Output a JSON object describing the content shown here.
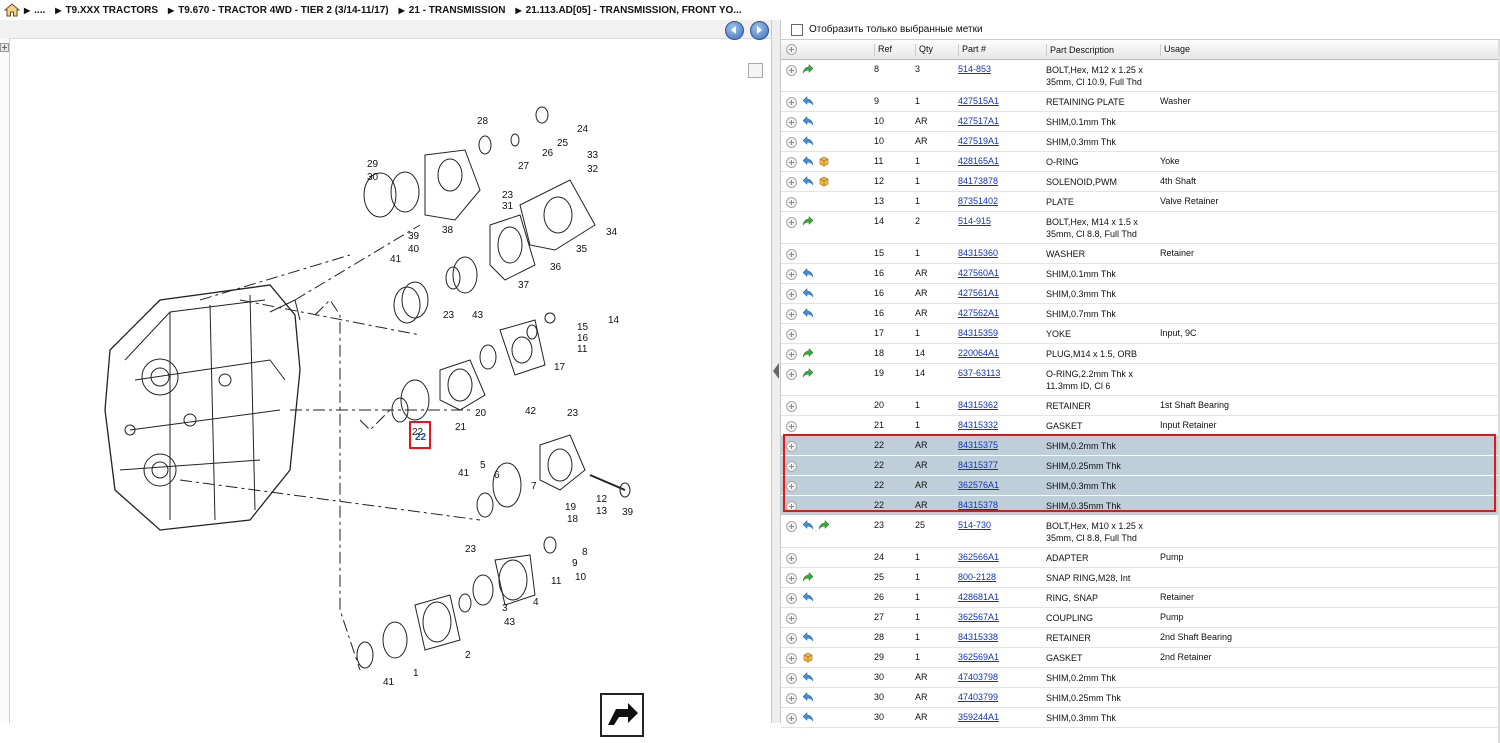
{
  "breadcrumb": {
    "items": [
      "....",
      "T9.XXX TRACTORS",
      "T9.670 - TRACTOR 4WD - TIER 2 (3/14-11/17)",
      "21 - TRANSMISSION",
      "21.113.AD[05] - TRANSMISSION, FRONT YO..."
    ]
  },
  "filter": {
    "label": "Отобразить только выбранные метки"
  },
  "table": {
    "headers": {
      "ref": "Ref",
      "qty": "Qty",
      "part": "Part #",
      "desc": "Part Description",
      "usage": "Usage"
    },
    "rows": [
      {
        "ref": "8",
        "qty": "3",
        "part": "514-853",
        "desc": "BOLT,Hex, M12 x 1.25 x 35mm, Cl 10.9, Full Thd",
        "usage": "",
        "icons": [
          "green-arrow-icon"
        ],
        "sel": false
      },
      {
        "ref": "9",
        "qty": "1",
        "part": "427515A1",
        "desc": "RETAINING PLATE",
        "usage": "Washer",
        "icons": [
          "blue-arrow-icon"
        ],
        "sel": false
      },
      {
        "ref": "10",
        "qty": "AR",
        "part": "427517A1",
        "desc": "SHIM,0.1mm Thk",
        "usage": "",
        "icons": [
          "blue-arrow-icon"
        ],
        "sel": false
      },
      {
        "ref": "10",
        "qty": "AR",
        "part": "427519A1",
        "desc": "SHIM,0.3mm Thk",
        "usage": "",
        "icons": [
          "blue-arrow-icon"
        ],
        "sel": false
      },
      {
        "ref": "11",
        "qty": "1",
        "part": "428165A1",
        "desc": "O-RING",
        "usage": "Yoke",
        "icons": [
          "blue-arrow-icon",
          "box-icon"
        ],
        "sel": false
      },
      {
        "ref": "12",
        "qty": "1",
        "part": "84173878",
        "desc": "SOLENOID,PWM",
        "usage": "4th Shaft",
        "icons": [
          "blue-arrow-icon",
          "box-icon"
        ],
        "sel": false
      },
      {
        "ref": "13",
        "qty": "1",
        "part": "87351402",
        "desc": "PLATE",
        "usage": "Valve Retainer",
        "icons": [],
        "sel": false
      },
      {
        "ref": "14",
        "qty": "2",
        "part": "514-915",
        "desc": "BOLT,Hex, M14 x 1.5 x 35mm, Cl 8.8, Full Thd",
        "usage": "",
        "icons": [
          "green-arrow-icon"
        ],
        "sel": false
      },
      {
        "ref": "15",
        "qty": "1",
        "part": "84315360",
        "desc": "WASHER",
        "usage": "Retainer",
        "icons": [],
        "sel": false
      },
      {
        "ref": "16",
        "qty": "AR",
        "part": "427560A1",
        "desc": "SHIM,0.1mm Thk",
        "usage": "",
        "icons": [
          "blue-arrow-icon"
        ],
        "sel": false
      },
      {
        "ref": "16",
        "qty": "AR",
        "part": "427561A1",
        "desc": "SHIM,0.3mm Thk",
        "usage": "",
        "icons": [
          "blue-arrow-icon"
        ],
        "sel": false
      },
      {
        "ref": "16",
        "qty": "AR",
        "part": "427562A1",
        "desc": "SHIM,0.7mm Thk",
        "usage": "",
        "icons": [
          "blue-arrow-icon"
        ],
        "sel": false
      },
      {
        "ref": "17",
        "qty": "1",
        "part": "84315359",
        "desc": "YOKE",
        "usage": "Input, 9C",
        "icons": [],
        "sel": false
      },
      {
        "ref": "18",
        "qty": "14",
        "part": "220064A1",
        "desc": "PLUG,M14 x 1.5, ORB",
        "usage": "",
        "icons": [
          "green-arrow-icon"
        ],
        "sel": false
      },
      {
        "ref": "19",
        "qty": "14",
        "part": "637-63113",
        "desc": "O-RING,2.2mm Thk x 11.3mm ID, Cl 6",
        "usage": "",
        "icons": [
          "green-arrow-icon"
        ],
        "sel": false
      },
      {
        "ref": "20",
        "qty": "1",
        "part": "84315362",
        "desc": "RETAINER",
        "usage": "1st Shaft Bearing",
        "icons": [],
        "sel": false
      },
      {
        "ref": "21",
        "qty": "1",
        "part": "84315332",
        "desc": "GASKET",
        "usage": "Input Retainer",
        "icons": [],
        "sel": false
      },
      {
        "ref": "22",
        "qty": "AR",
        "part": "84315375",
        "desc": "SHIM,0.2mm Thk",
        "usage": "",
        "icons": [],
        "sel": true
      },
      {
        "ref": "22",
        "qty": "AR",
        "part": "84315377",
        "desc": "SHIM,0.25mm Thk",
        "usage": "",
        "icons": [],
        "sel": true
      },
      {
        "ref": "22",
        "qty": "AR",
        "part": "362576A1",
        "desc": "SHIM,0.3mm Thk",
        "usage": "",
        "icons": [],
        "sel": true
      },
      {
        "ref": "22",
        "qty": "AR",
        "part": "84315378",
        "desc": "SHIM,0.35mm Thk",
        "usage": "",
        "icons": [],
        "sel": true
      },
      {
        "ref": "23",
        "qty": "25",
        "part": "514-730",
        "desc": "BOLT,Hex, M10 x 1.25 x 35mm, Cl 8.8, Full Thd",
        "usage": "",
        "icons": [
          "blue-arrow-icon",
          "green-arrow-icon"
        ],
        "sel": false
      },
      {
        "ref": "24",
        "qty": "1",
        "part": "362566A1",
        "desc": "ADAPTER",
        "usage": "Pump",
        "icons": [],
        "sel": false
      },
      {
        "ref": "25",
        "qty": "1",
        "part": "800-2128",
        "desc": "SNAP RING,M28, Int",
        "usage": "",
        "icons": [
          "green-arrow-icon"
        ],
        "sel": false
      },
      {
        "ref": "26",
        "qty": "1",
        "part": "428681A1",
        "desc": "RING, SNAP",
        "usage": "Retainer",
        "icons": [
          "blue-arrow-icon"
        ],
        "sel": false
      },
      {
        "ref": "27",
        "qty": "1",
        "part": "362567A1",
        "desc": "COUPLING",
        "usage": "Pump",
        "icons": [],
        "sel": false
      },
      {
        "ref": "28",
        "qty": "1",
        "part": "84315338",
        "desc": "RETAINER",
        "usage": "2nd Shaft Bearing",
        "icons": [
          "blue-arrow-icon"
        ],
        "sel": false
      },
      {
        "ref": "29",
        "qty": "1",
        "part": "362569A1",
        "desc": "GASKET",
        "usage": "2nd Retainer",
        "icons": [
          "box-icon"
        ],
        "sel": false
      },
      {
        "ref": "30",
        "qty": "AR",
        "part": "47403798",
        "desc": "SHIM,0.2mm Thk",
        "usage": "",
        "icons": [
          "blue-arrow-icon"
        ],
        "sel": false
      },
      {
        "ref": "30",
        "qty": "AR",
        "part": "47403799",
        "desc": "SHIM,0.25mm Thk",
        "usage": "",
        "icons": [
          "blue-arrow-icon"
        ],
        "sel": false
      },
      {
        "ref": "30",
        "qty": "AR",
        "part": "359244A1",
        "desc": "SHIM,0.3mm Thk",
        "usage": "",
        "icons": [
          "blue-arrow-icon"
        ],
        "sel": false
      }
    ]
  },
  "diagram": {
    "callouts": [
      "24",
      "25",
      "28",
      "26",
      "27",
      "29",
      "30",
      "23",
      "31",
      "33",
      "32",
      "34",
      "35",
      "36",
      "37",
      "38",
      "39",
      "40",
      "41",
      "23",
      "43",
      "14",
      "15",
      "16",
      "11",
      "17",
      "20",
      "21",
      "22",
      "42",
      "23",
      "5",
      "6",
      "7",
      "41",
      "19",
      "18",
      "12",
      "13",
      "39",
      "23",
      "8",
      "9",
      "10",
      "11",
      "4",
      "3",
      "43",
      "2",
      "1",
      "41"
    ],
    "selected_callout": "22"
  }
}
